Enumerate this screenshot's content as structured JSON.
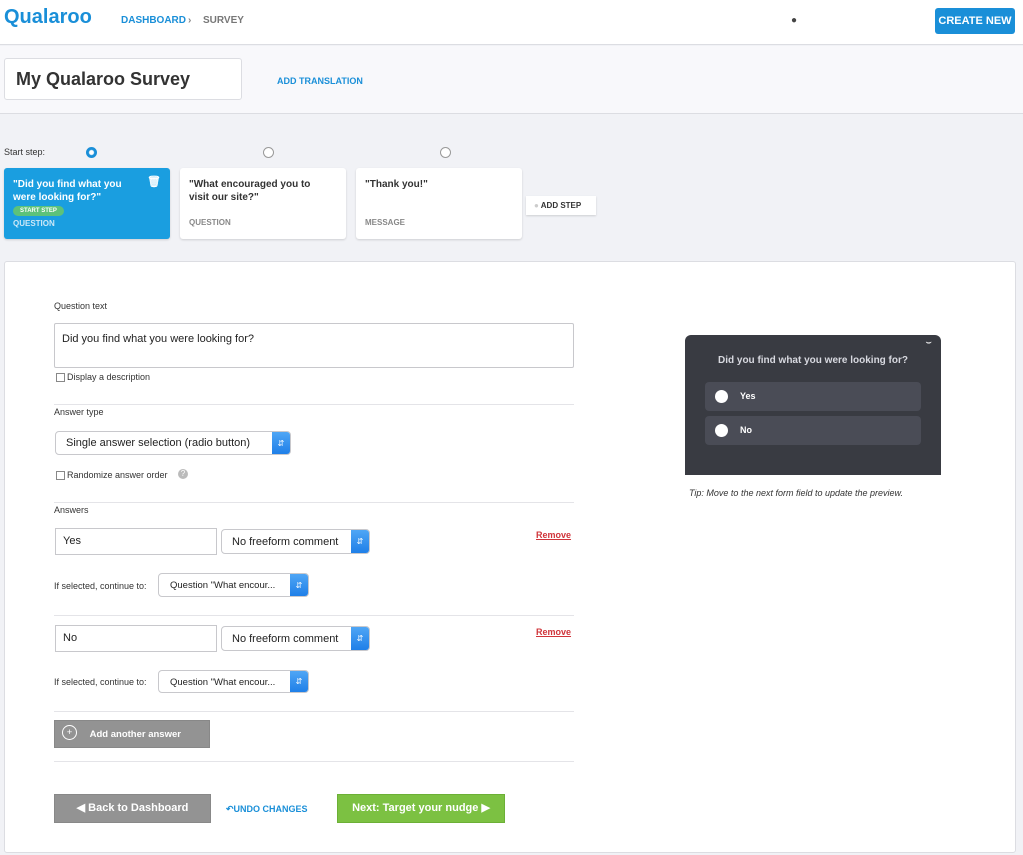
{
  "header": {
    "logo": "Qualaroo",
    "breadcrumb": [
      "DASHBOARD",
      "SURVEY"
    ],
    "breadcrumb_sep": "›",
    "user_icon": "user-icon",
    "create_new": "CREATE NEW"
  },
  "survey": {
    "title": "My Qualaroo Survey",
    "add_translation": "ADD TRANSLATION"
  },
  "steps": {
    "start_step_label": "Start step:",
    "selected_start_index": 0,
    "cards": [
      {
        "title": "\"Did you find what you were looking for?\"",
        "badge": "START STEP",
        "type": "QUESTION",
        "active": true
      },
      {
        "title": "\"What encouraged you to visit our site?\"",
        "type": "QUESTION"
      },
      {
        "title": "\"Thank you!\"",
        "type": "MESSAGE"
      }
    ],
    "add_step": "ADD STEP"
  },
  "form": {
    "question_text_label": "Question text",
    "question_text": "Did you find what you were looking for?",
    "display_description": "Display a description",
    "answer_type_label": "Answer type",
    "answer_type": "Single answer selection (radio button)",
    "randomize": "Randomize answer order",
    "answers_label": "Answers",
    "answers": [
      {
        "value": "Yes",
        "comment": "No freeform comment",
        "continue_label": "If selected, continue to:",
        "continue_to": "Question \"What encour...",
        "remove": "Remove"
      },
      {
        "value": "No",
        "comment": "No freeform comment",
        "continue_label": "If selected, continue to:",
        "continue_to": "Question \"What encour...",
        "remove": "Remove"
      }
    ],
    "add_answer": "Add another answer",
    "back": "Back to Dashboard",
    "undo": "UNDO CHANGES",
    "next": "Next: Target your nudge"
  },
  "preview": {
    "question": "Did you find what you were looking for?",
    "options": [
      "Yes",
      "No"
    ],
    "tip": "Tip: Move to the next form field to update the preview."
  },
  "colors": {
    "brand": "#1a8fd8",
    "active_card": "#1a9ee0",
    "next": "#7cc142",
    "remove": "#d0343a",
    "preview_bg": "#393b42"
  }
}
